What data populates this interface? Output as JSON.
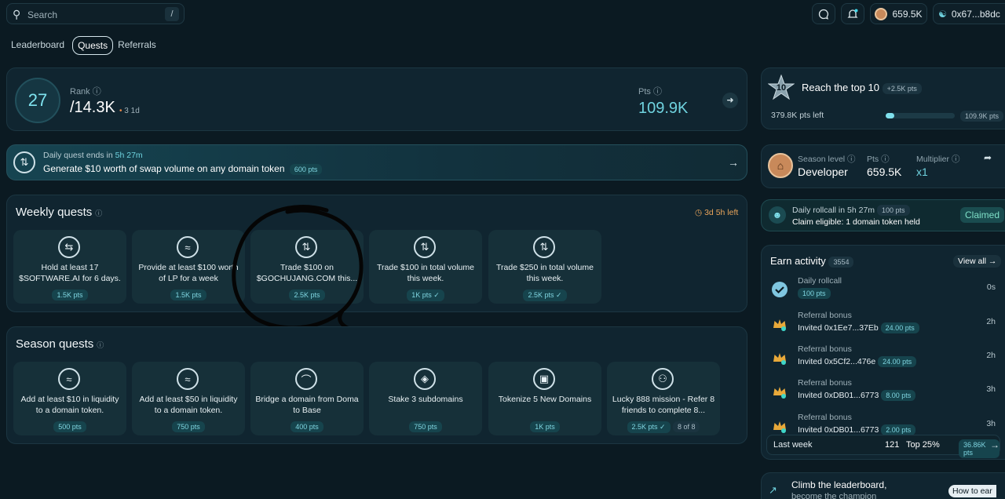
{
  "search": {
    "placeholder": "Search",
    "shortcut": "/"
  },
  "header": {
    "balance": "659.5K",
    "wallet": "0x67...b8dc"
  },
  "tabs": [
    {
      "label": "Leaderboard"
    },
    {
      "label": "Quests"
    },
    {
      "label": "Referrals"
    }
  ],
  "rank": {
    "number": "27",
    "label": "Rank",
    "total": "/14.3K",
    "change": "3 1d",
    "pts_label": "Pts",
    "pts_value": "109.9K"
  },
  "daily_quest": {
    "ends_prefix": "Daily quest ends in",
    "ends_time": "5h 27m",
    "title": "Generate $10 worth of swap volume on any domain token",
    "pts": "600 pts"
  },
  "weekly": {
    "title": "Weekly quests",
    "time_left": "3d 5h left",
    "items": [
      {
        "title": "Hold at least 17 $SOFTWARE.AI for 6 days.",
        "pts": "1.5K pts"
      },
      {
        "title": "Provide at least $100 worth of LP for a week",
        "pts": "1.5K pts"
      },
      {
        "title": "Trade $100 on $GOCHUJANG.COM this...",
        "pts": "2.5K pts"
      },
      {
        "title": "Trade $100 in total volume this week.",
        "pts": "1K pts ✓"
      },
      {
        "title": "Trade $250 in total volume this week.",
        "pts": "2.5K pts ✓"
      }
    ]
  },
  "season": {
    "title": "Season quests",
    "items": [
      {
        "title": "Add at least $10 in liquidity to a domain token.",
        "pts": "500 pts"
      },
      {
        "title": "Add at least $50 in liquidity to a domain token.",
        "pts": "750 pts"
      },
      {
        "title": "Bridge a domain from Doma to Base",
        "pts": "400 pts"
      },
      {
        "title": "Stake 3 subdomains",
        "pts": "750 pts"
      },
      {
        "title": "Tokenize 5 New Domains",
        "pts": "1K pts"
      },
      {
        "title": "Lucky 888 mission - Refer 8 friends to complete 8...",
        "pts": "2.5K pts ✓",
        "progress": "8 of 8"
      }
    ]
  },
  "top10": {
    "badge": "10",
    "title": "Reach the top 10",
    "bonus": "+2.5K pts",
    "left": "379.8K pts left",
    "pts": "109.9K pts",
    "progress": 0.12
  },
  "season_level": {
    "label": "Season level",
    "value": "Developer",
    "pts_label": "Pts",
    "pts_value": "659.5K",
    "mult_label": "Multiplier",
    "mult_value": "x1"
  },
  "rollcall": {
    "prefix": "Daily rollcall in",
    "time": "5h 27m",
    "pts": "100 pts",
    "desc": "Claim eligible: 1 domain token held",
    "status": "Claimed"
  },
  "earn": {
    "title": "Earn activity",
    "count": "3554",
    "view_all": "View all",
    "items": [
      {
        "cat": "Daily rollcall",
        "detail": "",
        "pts": "100 pts",
        "time": "0s"
      },
      {
        "cat": "Referral bonus",
        "detail": "Invited 0x1Ee7...37Eb",
        "pts": "24.00 pts",
        "time": "2h"
      },
      {
        "cat": "Referral bonus",
        "detail": "Invited 0x5Cf2...476e",
        "pts": "24.00 pts",
        "time": "2h"
      },
      {
        "cat": "Referral bonus",
        "detail": "Invited 0xDB01...6773",
        "pts": "8.00 pts",
        "time": "3h"
      },
      {
        "cat": "Referral bonus",
        "detail": "Invited 0xDB01...6773",
        "pts": "2.00 pts",
        "time": "3h"
      }
    ],
    "footer": {
      "label": "Last week",
      "count": "121",
      "top": "Top 25%",
      "pts": "36.86K pts"
    }
  },
  "climb": {
    "title": "Climb the leaderboard,",
    "subtitle": "become the champion",
    "how": "How to ear"
  }
}
